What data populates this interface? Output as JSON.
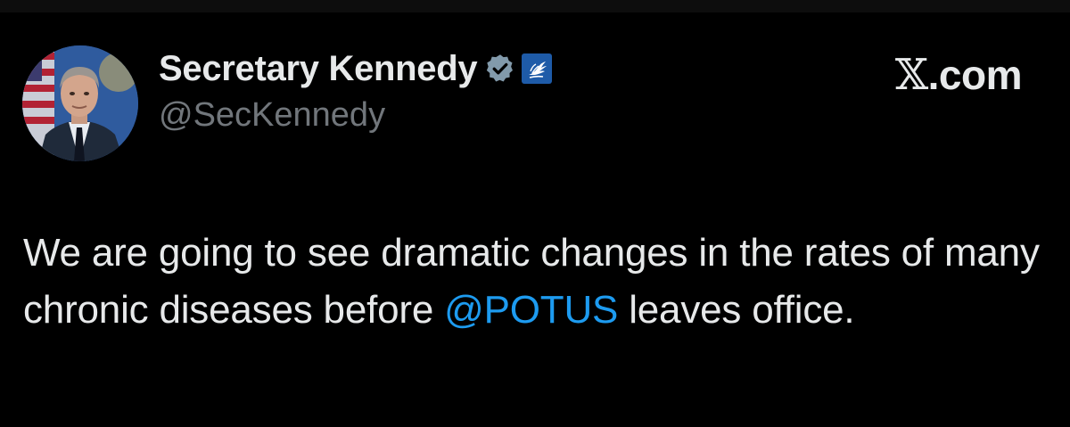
{
  "author": {
    "display_name": "Secretary Kennedy",
    "handle": "@SecKennedy",
    "verified_icon": "verified-badge-icon",
    "affiliation_icon": "hhs-eagle-logo-icon"
  },
  "brand": {
    "x_glyph": "𝕏",
    "suffix": ".com"
  },
  "tweet": {
    "text_before": "We are going to see dramatic changes in the rates of many chronic diseases before ",
    "mention": "@POTUS",
    "text_after": " leaves office."
  },
  "colors": {
    "background": "#000000",
    "primary_text": "#e7e9ea",
    "secondary_text": "#71767b",
    "link": "#1d9bf0",
    "verified_badge": "#829aab",
    "affiliation_badge": "#1e5ba8"
  }
}
